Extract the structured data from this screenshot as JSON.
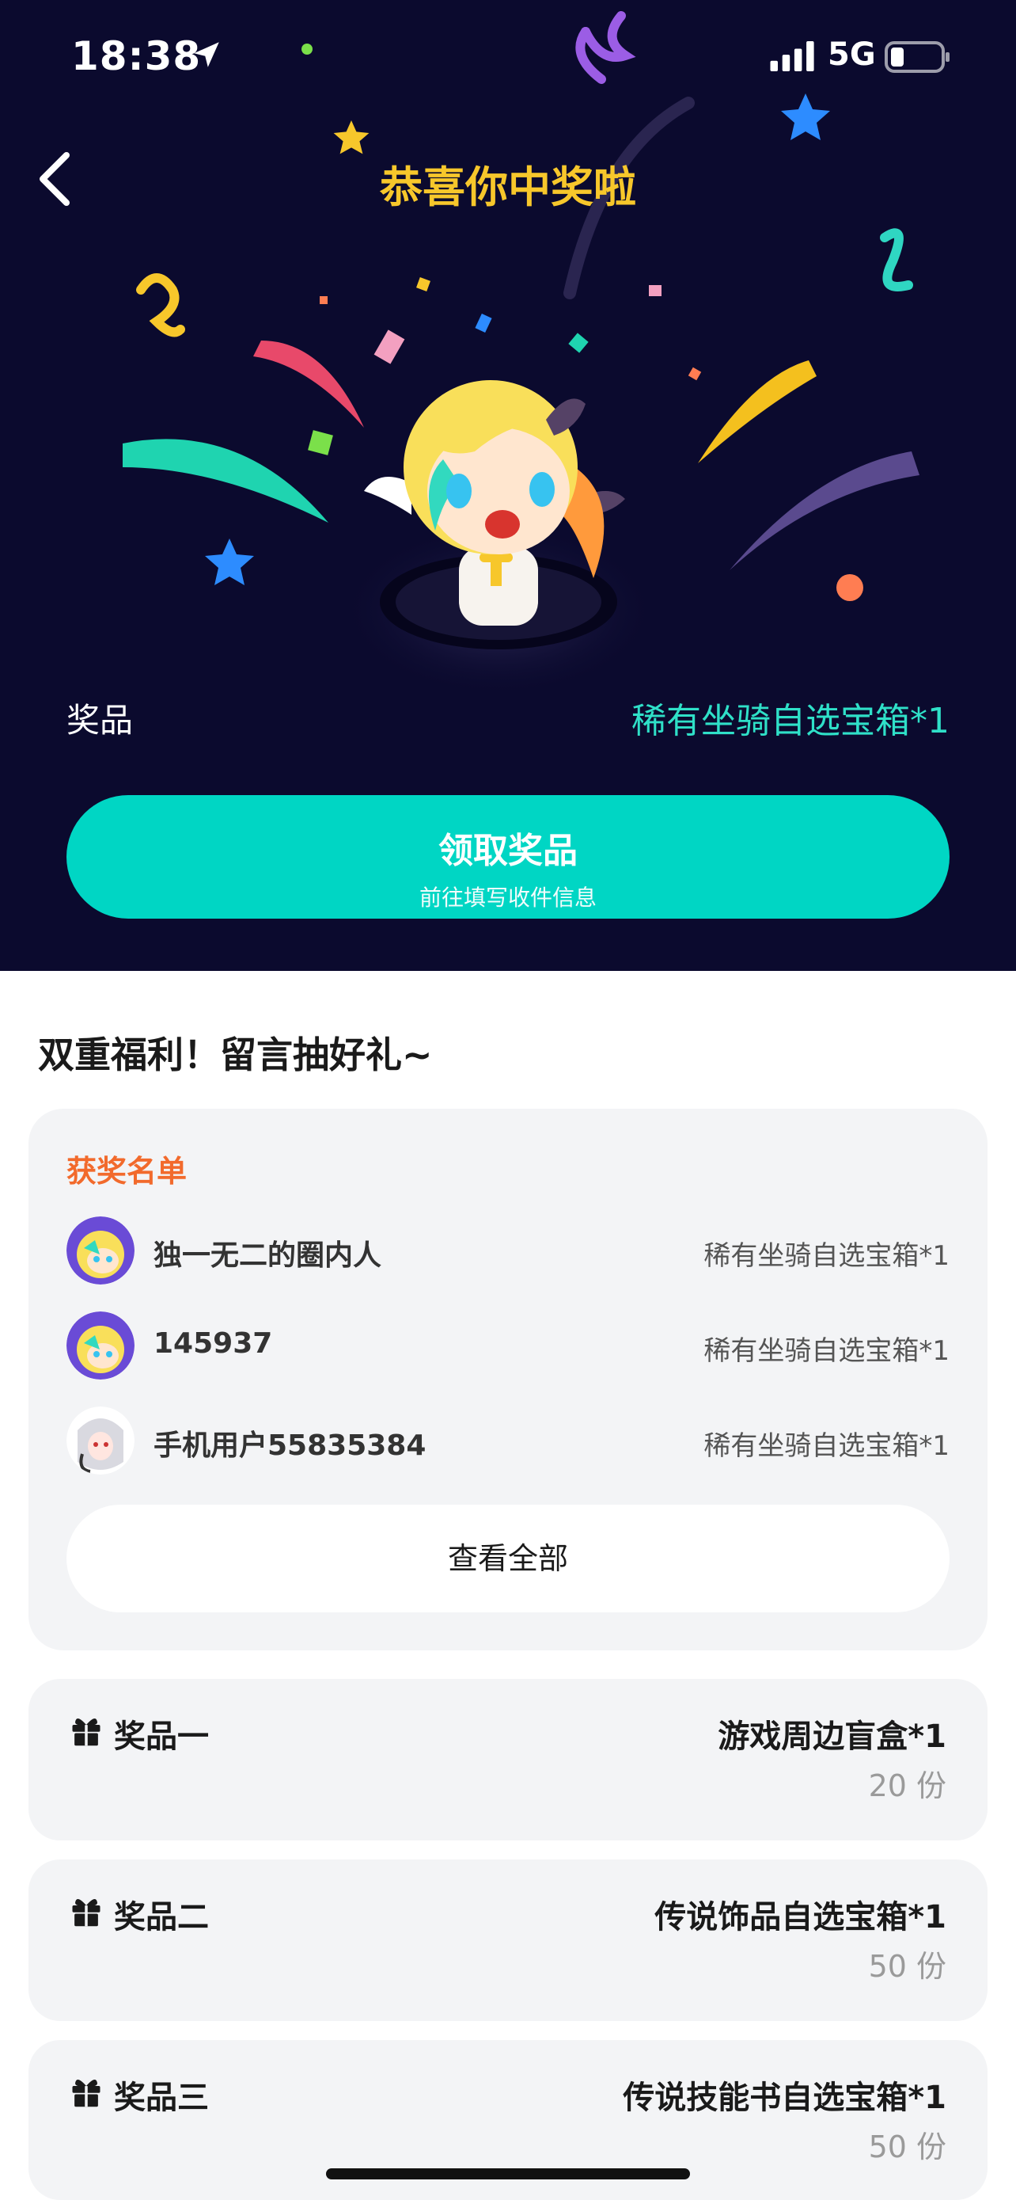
{
  "status_bar": {
    "time": "18:38",
    "network": "5G"
  },
  "header": {
    "title": "恭喜你中奖啦"
  },
  "prize": {
    "label": "奖品",
    "value": "稀有坐骑自选宝箱*1"
  },
  "claim_button": {
    "title": "领取奖品",
    "subtitle": "前往填写收件信息"
  },
  "section_title": "双重福利！留言抽好礼~",
  "winners": {
    "heading": "获奖名单",
    "rows": [
      {
        "name": "独一无二的圈内人",
        "prize": "稀有坐骑自选宝箱*1"
      },
      {
        "name": "145937",
        "prize": "稀有坐骑自选宝箱*1"
      },
      {
        "name": "手机用户55835384",
        "prize": "稀有坐骑自选宝箱*1"
      }
    ],
    "view_all": "查看全部"
  },
  "prizes": [
    {
      "tier": "奖品一",
      "name": "游戏周边盲盒*1",
      "count": "20 份"
    },
    {
      "tier": "奖品二",
      "name": "传说饰品自选宝箱*1",
      "count": "50 份"
    },
    {
      "tier": "奖品三",
      "name": "传说技能书自选宝箱*1",
      "count": "50 份"
    }
  ],
  "colors": {
    "hero_bg": "#0b0a2e",
    "title": "#f7c72b",
    "accent": "#00d6c4",
    "prize_value": "#2fe0c8",
    "winners_heading": "#f26a2c"
  },
  "icons": [
    "location-arrow-icon",
    "signal-icon",
    "battery-icon",
    "back-chevron-icon",
    "gift-icon"
  ]
}
